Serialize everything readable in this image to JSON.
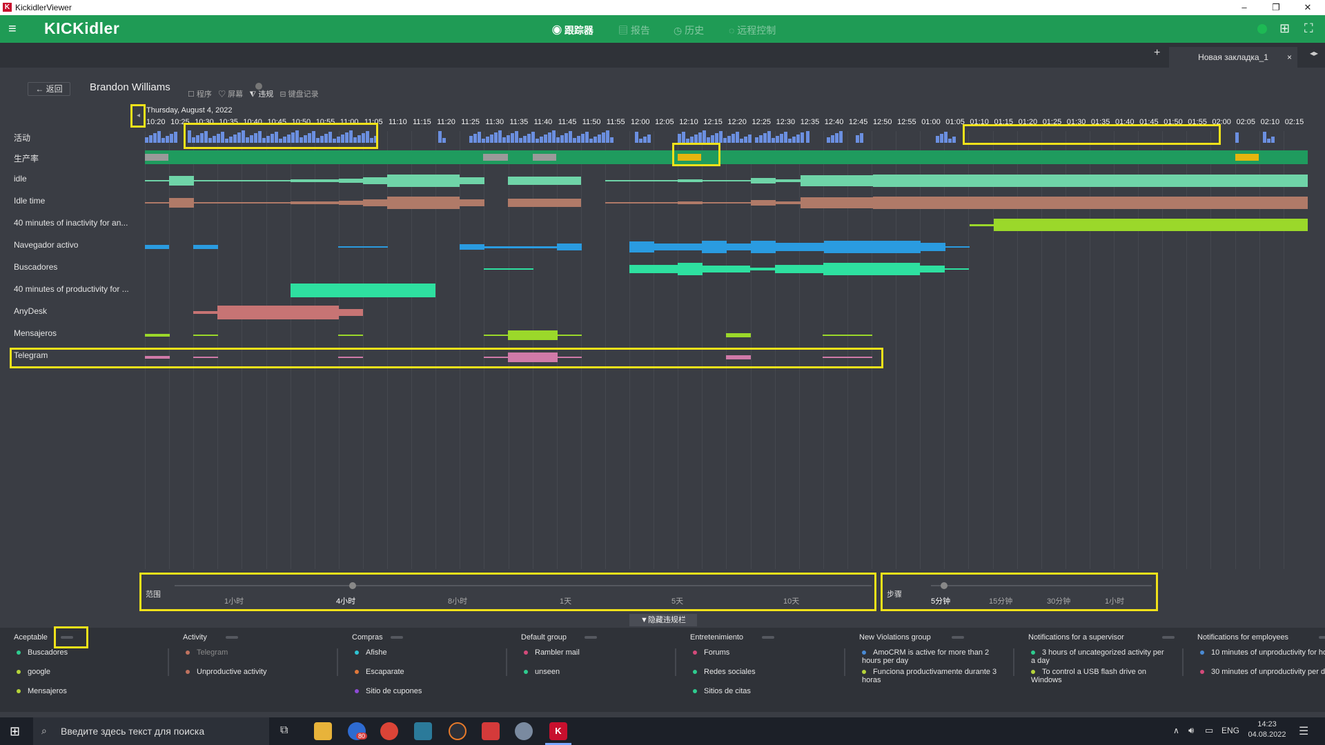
{
  "window": {
    "title": "KickidlerViewer",
    "min": "–",
    "max": "❐",
    "close": "✕"
  },
  "app": {
    "brand": "KICKidler",
    "nav": [
      {
        "label": "跟踪器",
        "icon": "eye-icon",
        "active": true
      },
      {
        "label": "报告",
        "icon": "report-icon",
        "active": false
      },
      {
        "label": "历史",
        "icon": "history-icon",
        "active": false
      },
      {
        "label": "远程控制",
        "icon": "remote-icon",
        "active": false
      }
    ]
  },
  "tabs": {
    "plus": "+",
    "current": "Новая закладка_1",
    "close": "×",
    "arrows": "◂▸"
  },
  "employee": {
    "back_label": "返回",
    "name": "Brandon Williams",
    "view_opts": [
      "程序",
      "屏幕",
      "违规",
      "键盘记录"
    ]
  },
  "timeline": {
    "date": "Thursday, August 4, 2022",
    "ticks": [
      "10:20",
      "10:25",
      "10:30",
      "10:35",
      "10:40",
      "10:45",
      "10:50",
      "10:55",
      "11:00",
      "11:05",
      "11:10",
      "11:15",
      "11:20",
      "11:25",
      "11:30",
      "11:35",
      "11:40",
      "11:45",
      "11:50",
      "11:55",
      "12:00",
      "12:05",
      "12:10",
      "12:15",
      "12:20",
      "12:25",
      "12:30",
      "12:35",
      "12:40",
      "12:45",
      "12:50",
      "12:55",
      "01:00",
      "01:05",
      "01:10",
      "01:15",
      "01:20",
      "01:25",
      "01:30",
      "01:35",
      "01:40",
      "01:45",
      "01:50",
      "01:55",
      "02:00",
      "02:05",
      "02:10",
      "02:15"
    ],
    "rows": [
      "活动",
      "生产率",
      "idle",
      "Idle time",
      "40 minutes of inactivity for an...",
      "Navegador activo",
      "Buscadores",
      "40 minutes of productivity for ...",
      "AnyDesk",
      "Mensajeros",
      "Telegram"
    ]
  },
  "sliders": {
    "range_label": "范围",
    "range_steps": [
      "1小时",
      "4小时",
      "8小时",
      "1天",
      "5天",
      "10天"
    ],
    "range_selected": "4小时",
    "step_label": "步骤",
    "step_steps": [
      "5分钟",
      "15分钟",
      "30分钟",
      "1小时"
    ],
    "step_selected": "5分钟",
    "hide_btn": "隐藏违规栏"
  },
  "legend": [
    {
      "title": "Aceptable",
      "items": [
        {
          "label": "Buscadores",
          "color": "#2ecc8f"
        },
        {
          "label": "google",
          "color": "#b6d43a"
        },
        {
          "label": "Mensajeros",
          "color": "#b6d43a"
        }
      ]
    },
    {
      "title": "Activity",
      "items": [
        {
          "label": "Telegram",
          "color": "#c0725f",
          "muted": true
        },
        {
          "label": "Unproductive activity",
          "color": "#c0725f"
        }
      ]
    },
    {
      "title": "Compras",
      "items": [
        {
          "label": "Afishe",
          "color": "#2ec4d4"
        },
        {
          "label": "Escaparate",
          "color": "#e0783a"
        },
        {
          "label": "Sitio de cupones",
          "color": "#8e4ad6"
        }
      ]
    },
    {
      "title": "Default group",
      "items": [
        {
          "label": "Rambler mail",
          "color": "#d44a7a"
        },
        {
          "label": "unseen",
          "color": "#2ecc8f"
        }
      ]
    },
    {
      "title": "Entretenimiento",
      "items": [
        {
          "label": "Forums",
          "color": "#d44a7a"
        },
        {
          "label": "Redes sociales",
          "color": "#2ecc8f"
        },
        {
          "label": "Sitios de citas",
          "color": "#2ecc8f"
        }
      ]
    },
    {
      "title": "New Violations group",
      "items": [
        {
          "label": "AmoCRM is active for more than 2 hours per day",
          "color": "#4a8ad4"
        },
        {
          "label": "Funciona productivamente durante 3 horas",
          "color": "#b6d43a"
        }
      ]
    },
    {
      "title": "Notifications for a supervisor",
      "items": [
        {
          "label": "3 hours of uncategorized activity per a day",
          "color": "#2ecc8f"
        },
        {
          "label": "To control a USB flash drive on Windows",
          "color": "#b6d43a"
        }
      ]
    },
    {
      "title": "Notifications for employees",
      "items": [
        {
          "label": "10 minutes of unproductivity for hour",
          "color": "#4a8ad4"
        },
        {
          "label": "30 minutes of unproductivity per day",
          "color": "#d44a7a"
        }
      ]
    }
  ],
  "taskbar": {
    "search_placeholder": "Введите здесь текст для поиска",
    "lang": "ENG",
    "time": "14:23",
    "date": "04.08.2022",
    "badge": "80"
  },
  "colors": {
    "accent": "#1f9b55",
    "highlight": "#f1e21a"
  }
}
